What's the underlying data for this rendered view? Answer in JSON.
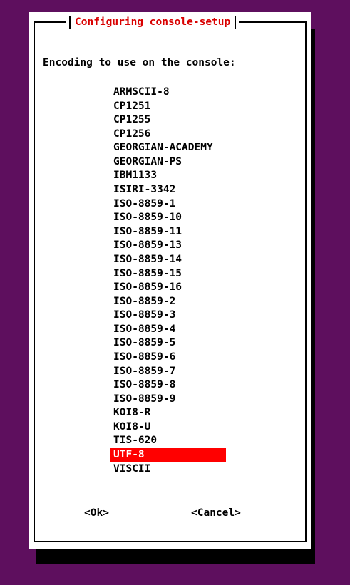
{
  "dialog": {
    "title": "Configuring console-setup",
    "prompt": "Encoding to use on the console:",
    "selected_index": 26,
    "options": [
      "ARMSCII-8",
      "CP1251",
      "CP1255",
      "CP1256",
      "GEORGIAN-ACADEMY",
      "GEORGIAN-PS",
      "IBM1133",
      "ISIRI-3342",
      "ISO-8859-1",
      "ISO-8859-10",
      "ISO-8859-11",
      "ISO-8859-13",
      "ISO-8859-14",
      "ISO-8859-15",
      "ISO-8859-16",
      "ISO-8859-2",
      "ISO-8859-3",
      "ISO-8859-4",
      "ISO-8859-5",
      "ISO-8859-6",
      "ISO-8859-7",
      "ISO-8859-8",
      "ISO-8859-9",
      "KOI8-R",
      "KOI8-U",
      "TIS-620",
      "UTF-8",
      "VISCII"
    ],
    "ok_label": "<Ok>",
    "cancel_label": "<Cancel>"
  },
  "colors": {
    "background": "#5e0f5e",
    "dialog_bg": "#ffffff",
    "title": "#d90000",
    "selection_bg": "#ff0000",
    "selection_fg": "#ffffff"
  }
}
